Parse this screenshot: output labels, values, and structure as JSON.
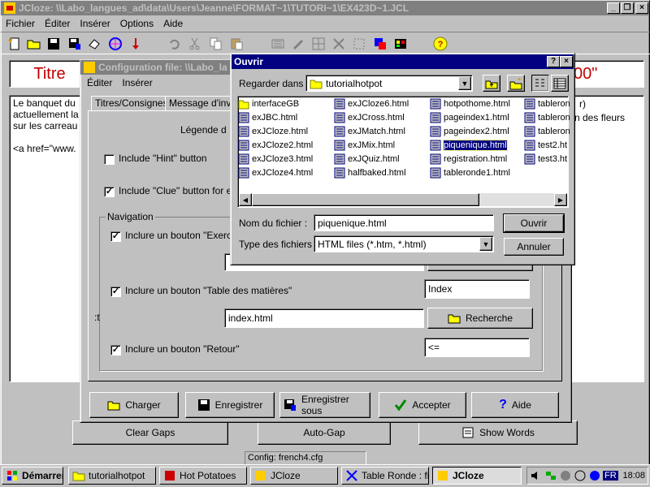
{
  "main_window": {
    "title": "JCloze: \\\\Labo_langues_ad\\data\\Users\\Jeanne\\FORMAT~1\\TUTORI~1\\EX423D~1.JCL",
    "menu": [
      "Fichier",
      "Éditer",
      "Insérer",
      "Options",
      "Aide"
    ],
    "title_label": "Titre",
    "title_right_fragment": "00\"",
    "body_text_lines": [
      "Le banquet du",
      "actuellement la",
      "sur les carreau",
      "",
      "<a href=\"www."
    ],
    "body_right_lines": [
      "r)",
      "n des fleurs"
    ],
    "bottom_buttons": [
      "Clear Gaps",
      "Auto-Gap",
      "Show Words"
    ],
    "status": "Config: french4.cfg"
  },
  "config_dialog": {
    "title": "Configuration file: \\\\Labo_la",
    "menu": [
      "Éditer",
      "Insérer"
    ],
    "tabs": [
      "Titres/Consignes",
      "Message d'invite"
    ],
    "legend_fragment": "Légende d",
    "include_hint": "Include \"Hint\" button",
    "include_clue": "Include \"Clue\" button for e",
    "navigation_group": "Navigation",
    "nav_exercise": "Inclure un bouton \"Exerc",
    "nav_toc": "Inclure un bouton \"Table des matières\"",
    "toc_caption": "Index",
    "toc_file": "index.html",
    "search_button": "Recherche",
    "nav_back": "Inclure un bouton \"Retour\"",
    "back_caption": "<=",
    "left_fragment": ":t",
    "buttons": [
      "Charger",
      "Enregistrer",
      "Enregistrer sous",
      "Accepter",
      "Aide"
    ]
  },
  "open_dialog": {
    "title": "Ouvrir",
    "look_in_label": "Regarder dans :",
    "look_in_value": "tutorialhotpot",
    "files": [
      [
        "interfaceGB",
        "exJCloze6.html",
        "hotpothome.html",
        "tableron"
      ],
      [
        "exJBC.html",
        "exJCross.html",
        "pageindex1.html",
        "tableron"
      ],
      [
        "exJCloze.html",
        "exJMatch.html",
        "pageindex2.html",
        "tableron"
      ],
      [
        "exJCloze2.html",
        "exJMix.html",
        "piquenique.html",
        "test2.ht"
      ],
      [
        "exJCloze3.html",
        "exJQuiz.html",
        "registration.html",
        "test3.ht"
      ],
      [
        "exJCloze4.html",
        "halfbaked.html",
        "tableronde1.html",
        ""
      ]
    ],
    "selected_file": "piquenique.html",
    "filename_label": "Nom du fichier :",
    "filename_value": "piquenique.html",
    "filetype_label": "Type des fichiers :",
    "filetype_value": "HTML files (*.htm, *.html)",
    "open_button": "Ouvrir",
    "cancel_button": "Annuler"
  },
  "taskbar": {
    "start": "Démarrer",
    "items": [
      "tutorialhotpot",
      "Hot Potatoes",
      "JCloze",
      "Table Ronde : fi",
      "JCloze"
    ],
    "clock": "18:08",
    "lang": "FR"
  },
  "colors": {
    "desktop": "#008080",
    "face": "#c0c0c0",
    "active_title": "#000080",
    "title_red": "#c00000"
  }
}
